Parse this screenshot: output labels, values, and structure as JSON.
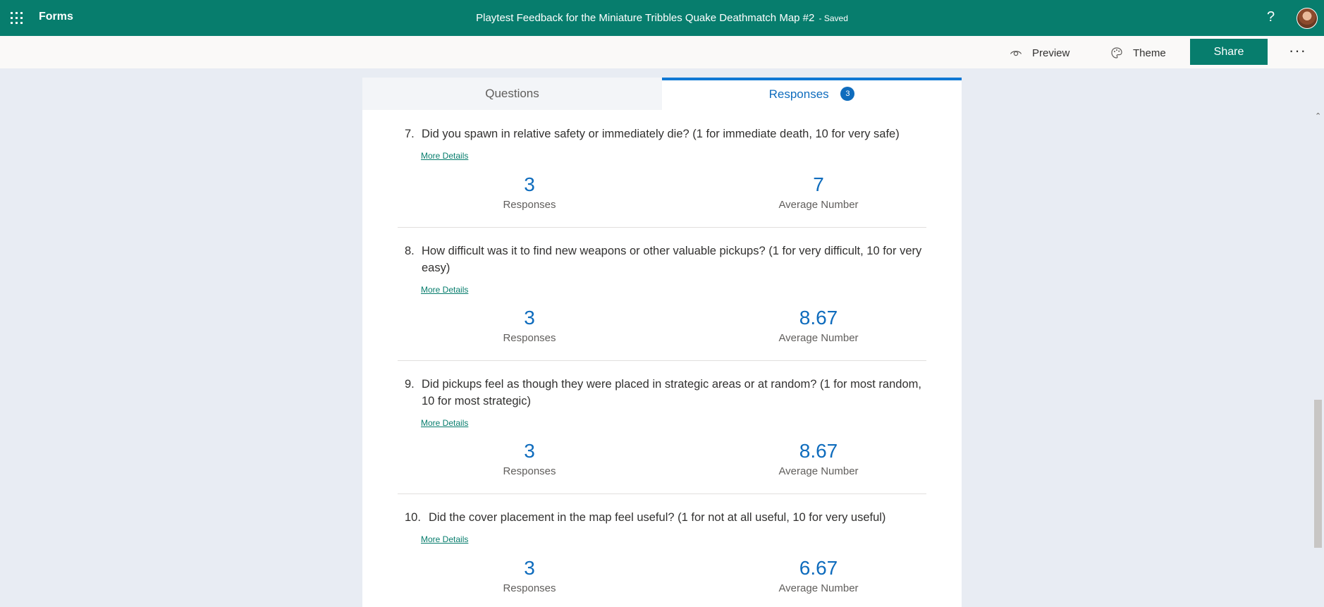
{
  "header": {
    "app_name": "Forms",
    "form_title": "Playtest Feedback for the Miniature Tribbles Quake Deathmatch Map #2",
    "saved_status": "- Saved",
    "help_label": "?"
  },
  "toolbar": {
    "preview_label": "Preview",
    "theme_label": "Theme",
    "share_label": "Share",
    "more_label": "···"
  },
  "tabs": {
    "questions_label": "Questions",
    "responses_label": "Responses",
    "responses_count": "3"
  },
  "questions": [
    {
      "number": "7.",
      "text": "Did you spawn in relative safety or immediately die? (1 for immediate death, 10 for very safe)",
      "more_details": "More Details",
      "responses_value": "3",
      "responses_label": "Responses",
      "average_value": "7",
      "average_label": "Average Number"
    },
    {
      "number": "8.",
      "text": "How difficult was it to find new weapons or other valuable pickups? (1 for very difficult, 10 for very easy)",
      "more_details": "More Details",
      "responses_value": "3",
      "responses_label": "Responses",
      "average_value": "8.67",
      "average_label": "Average Number"
    },
    {
      "number": "9.",
      "text": "Did pickups feel as though they were placed in strategic areas or at random? (1 for most random, 10 for most strategic)",
      "more_details": "More Details",
      "responses_value": "3",
      "responses_label": "Responses",
      "average_value": "8.67",
      "average_label": "Average Number"
    },
    {
      "number": "10.",
      "text": "Did the cover placement in the map feel useful? (1 for not at all useful, 10 for very useful)",
      "more_details": "More Details",
      "responses_value": "3",
      "responses_label": "Responses",
      "average_value": "6.67",
      "average_label": "Average Number"
    }
  ],
  "colors": {
    "brand": "#077d6d",
    "accent": "#0f6cbd",
    "background": "#e8ecf3"
  },
  "icons": {
    "app_launcher": "waffle-icon",
    "preview": "eye-icon",
    "theme": "palette-icon",
    "scroll_up": "chevron-up-icon"
  }
}
